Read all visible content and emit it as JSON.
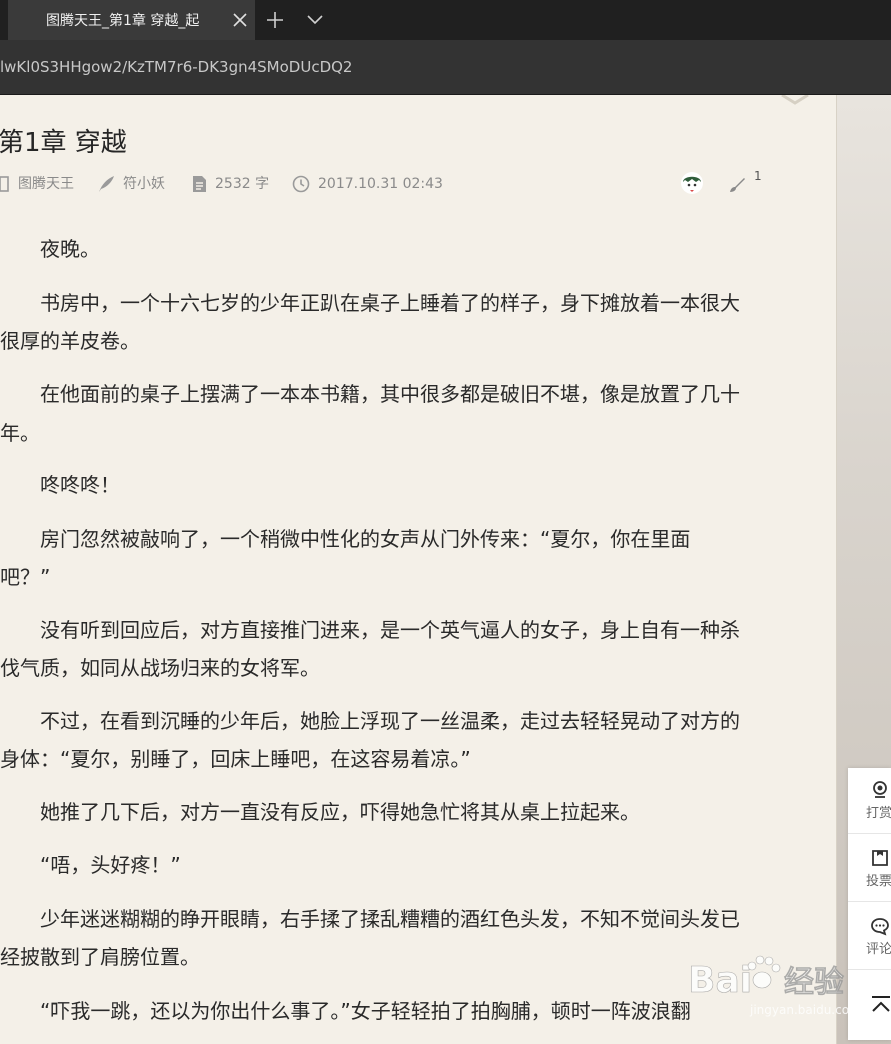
{
  "browser": {
    "tab_title": "图腾天王_第1章 穿越_起",
    "address": "lwKl0S3HHgow2/KzTM7r6-DK3gn4SMoDUcDQ2"
  },
  "chapter": {
    "title": "第1章 穿越",
    "book": "图腾天王",
    "author": "符小妖",
    "words": "2532 字",
    "date": "2017.10.31 02:43",
    "edit_count": "1"
  },
  "paragraphs": [
    "　　夜晚。",
    "　　书房中，一个十六七岁的少年正趴在桌子上睡着了的样子，身下摊放着一本很大",
    "很厚的羊皮卷。",
    "　　在他面前的桌子上摆满了一本本书籍，其中很多都是破旧不堪，像是放置了几十",
    "年。",
    "　　咚咚咚！",
    "　　房门忽然被敲响了，一个稍微中性化的女声从门外传来：“夏尔，你在里面",
    "吧？”",
    "　　没有听到回应后，对方直接推门进来，是一个英气逼人的女子，身上自有一种杀",
    "伐气质，如同从战场归来的女将军。",
    "　　不过，在看到沉睡的少年后，她脸上浮现了一丝温柔，走过去轻轻晃动了对方的",
    "身体：“夏尔，别睡了，回床上睡吧，在这容易着凉。”",
    "　　她推了几下后，对方一直没有反应，吓得她急忙将其从桌上拉起来。",
    "　　“唔，头好疼！”",
    "　　少年迷迷糊糊的睁开眼睛，右手揉了揉乱糟糟的酒红色头发，不知不觉间头发已",
    "经披散到了肩膀位置。",
    "　　“吓我一跳，还以为你出什么事了。”女子轻轻拍了拍胸脯，顿时一阵波浪翻"
  ],
  "sidemenu": {
    "reward": "打赏",
    "vote": "投票",
    "comment": "评论"
  },
  "watermark": {
    "brand": "Bai",
    "brand2": "经验",
    "url": "jingyan.baidu.com"
  }
}
